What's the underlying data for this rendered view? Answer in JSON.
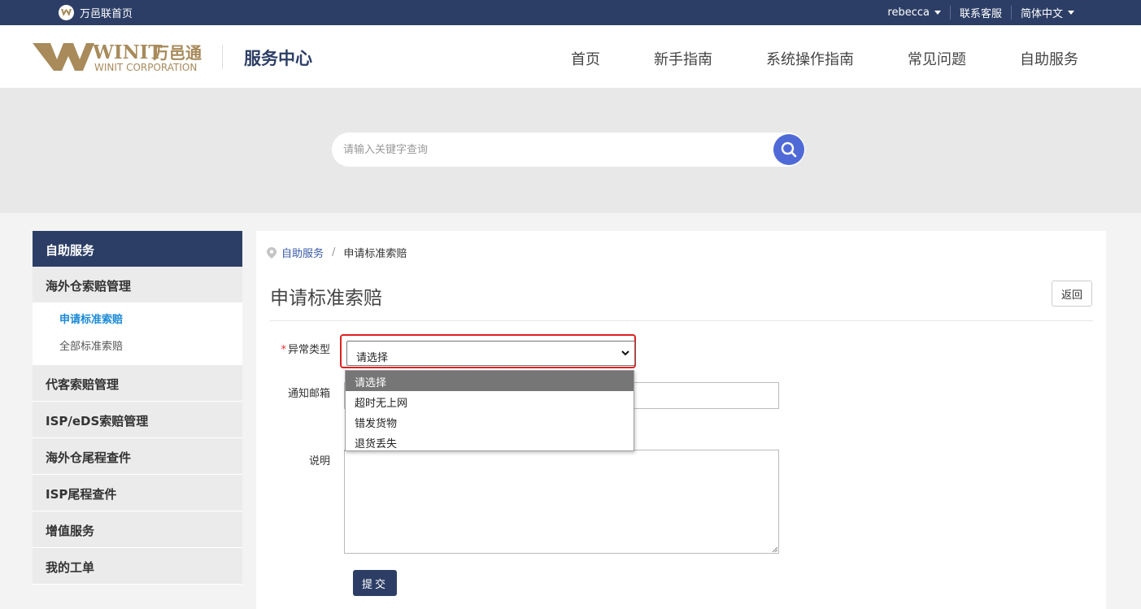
{
  "topbar": {
    "home_label": "万邑联首页",
    "user": "rebecca",
    "service": "联系客服",
    "language": "简体中文"
  },
  "header": {
    "logo_brand": "WINIT",
    "logo_cn": "万邑通",
    "logo_sub": "WINIT CORPORATION",
    "site_title": "服务中心",
    "nav": [
      "首页",
      "新手指南",
      "系统操作指南",
      "常见问题",
      "自助服务"
    ]
  },
  "search": {
    "placeholder": "请输入关键字查询"
  },
  "sidebar": {
    "title": "自助服务",
    "groups": [
      "海外仓索赔管理",
      "代客索赔管理",
      "ISP/eDS索赔管理",
      "海外仓尾程查件",
      "ISP尾程查件",
      "增值服务",
      "我的工单"
    ],
    "sub_items": [
      "申请标准索赔",
      "全部标准索赔"
    ]
  },
  "breadcrumb": {
    "parent": "自助服务",
    "separator": "/",
    "current": "申请标准索赔"
  },
  "form": {
    "title": "申请标准索赔",
    "back_label": "返回",
    "required_mark": "*",
    "type_label": "异常类型",
    "type_value": "请选择",
    "type_options": [
      "请选择",
      "超时无上网",
      "错发货物",
      "退货丢失"
    ],
    "email_label": "通知邮箱",
    "email_value": "",
    "desc_label": "说明",
    "desc_value": "",
    "submit_label": "提交"
  },
  "colors": {
    "navy": "#2d3e66",
    "accent_blue": "#4f6ad6",
    "link_blue": "#1a8ad6",
    "highlight_red": "#e02020",
    "logo_gold": "#a88a5b"
  }
}
